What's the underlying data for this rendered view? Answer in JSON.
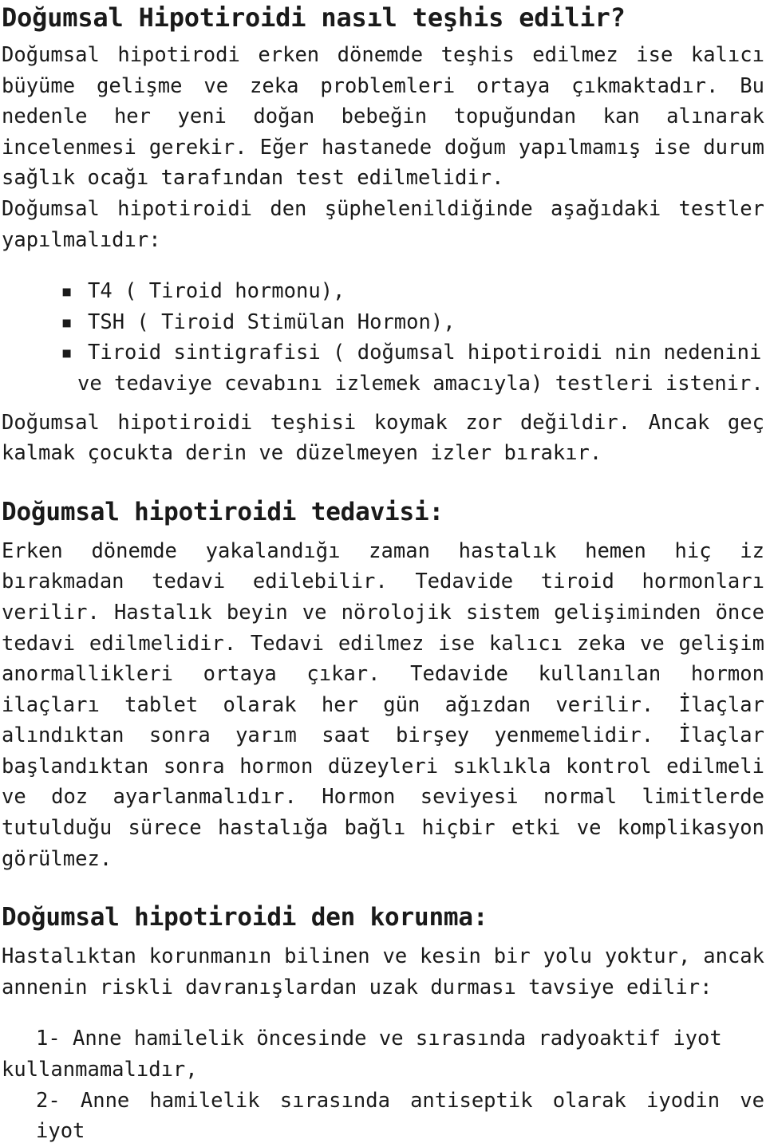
{
  "document": {
    "language": "Turkish",
    "text_color": "#1a1a1a",
    "background_color": "#ffffff",
    "title": "Doğumsal Hipotiroidi nasıl teşhis edilir?"
  },
  "intro": {
    "paragraph": "Doğumsal hipotirodi erken dönemde teşhis edilmez ise kalıcı büyüme gelişme ve zeka problemleri ortaya çıkmaktadır. Bu nedenle her yeni doğan bebeğin topuğundan kan alınarak incelenmesi gerekir. Eğer hastanede doğum yapılmamış ise durum sağlık ocağı tarafından test edilmelidir."
  },
  "tests_intro": {
    "paragraph": "Doğumsal hipotiroidi den şüphelenildiğinde aşağıdaki testler yapılmalıdır:"
  },
  "tests_list": {
    "bullet_glyph": "▪",
    "items": [
      {
        "text": "T4 ( Tiroid hormonu),"
      },
      {
        "text": "TSH ( Tiroid Stimülan Hormon),"
      },
      {
        "text": "Tiroid sintigrafisi ( doğumsal hipotiroidi nin nedenini",
        "continuation": "ve tedaviye cevabını izlemek amacıyla) testleri istenir."
      }
    ]
  },
  "diagnosis_note": {
    "paragraph": "Doğumsal hipotiroidi teşhisi koymak zor değildir. Ancak geç kalmak çocukta derin ve düzelmeyen izler bırakır."
  },
  "treatment": {
    "heading": "Doğumsal hipotiroidi tedavisi:",
    "paragraph": "Erken dönemde yakalandığı zaman hastalık hemen hiç iz bırakmadan tedavi edilebilir. Tedavide tiroid hormonları verilir. Hastalık beyin ve nörolojik sistem gelişiminden önce tedavi edilmelidir. Tedavi edilmez ise kalıcı zeka ve gelişim anormallikleri ortaya çıkar. Tedavide kullanılan hormon ilaçları tablet olarak her gün ağızdan verilir. İlaçlar alındıktan sonra yarım saat birşey yenmemelidir. İlaçlar başlandıktan sonra hormon düzeyleri sıklıkla kontrol edilmeli ve doz ayarlanmalıdır. Hormon seviyesi normal limitlerde tutulduğu sürece hastalığa bağlı hiçbir etki ve komplikasyon görülmez."
  },
  "prevention": {
    "heading": "Doğumsal hipotiroidi den korunma:",
    "paragraph": "Hastalıktan korunmanın bilinen ve kesin bir yolu yoktur, ancak annenin riskli davranışlardan uzak durması tavsiye edilir:",
    "items": [
      {
        "marker": "1-",
        "first_line": "1- Anne hamilelik öncesinde ve sırasında radyoaktif iyot",
        "rest": "kullanmamalıdır,"
      },
      {
        "marker": "2-",
        "first_line": "2- Anne hamilelik sırasında antiseptik olarak iyodin ve iyot",
        "rest": ""
      }
    ]
  }
}
